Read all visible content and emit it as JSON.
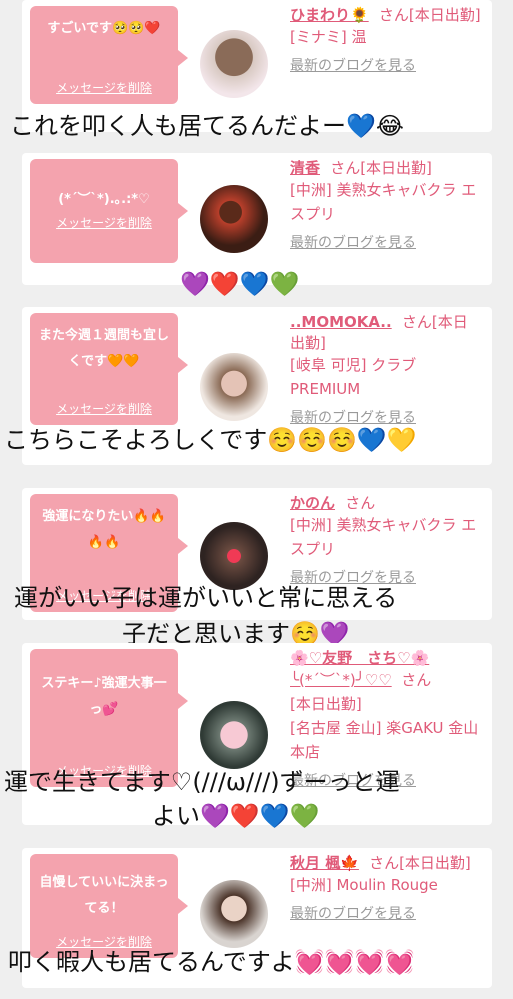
{
  "cards": [
    {
      "message": "すごいです🥺🥺❤️",
      "delete_label": "メッセージを削除",
      "name": "ひまわり🌻",
      "suffix": "さん[本日出勤]",
      "detail": "[ミナミ] 温",
      "blog": "最新のブログを見る"
    },
    {
      "message": "(*´︶`*).｡.:*♡",
      "delete_label": "メッセージを削除",
      "name": "清香",
      "suffix": "さん[本日出勤]",
      "detail": "[中洲] 美熟女キャバクラ エスプリ",
      "blog": "最新のブログを見る"
    },
    {
      "message": "また今週１週間も宜しくです🧡🧡",
      "delete_label": "メッセージを削除",
      "name": "..MOMOKA..",
      "suffix": "さん[本日出勤]",
      "detail": "[岐阜 可児] クラブ PREMIUM",
      "blog": "最新のブログを見る"
    },
    {
      "message": "強運になりたい🔥🔥🔥🔥",
      "delete_label": "メッセージを削除",
      "name": "かのん",
      "suffix": "さん",
      "detail": "[中洲] 美熟女キャバクラ エスプリ",
      "blog": "最新のブログを見る"
    },
    {
      "message": "ステキー♪強運大事一っ💕",
      "delete_label": "メッセージを削除",
      "name": "🌸♡友野　さち♡🌸",
      "suffix": "さん",
      "name_sub": "╰(*´︶`*)╯♡♡",
      "status": "[本日出勤]",
      "detail": "[名古屋 金山] 楽GAKU 金山本店",
      "blog": "最新のブログを見る"
    },
    {
      "message": "自慢していいに決まってる！",
      "delete_label": "メッセージを削除",
      "name": "秋月 楓🍁",
      "suffix": "さん[本日出勤]",
      "detail": "[中洲] Moulin Rouge",
      "blog": "最新のブログを見る"
    }
  ],
  "overlays": {
    "o1": "これを叩く人も居てるんだよー💙😂",
    "o2": "💜❤️💙💚",
    "o3": "こちらこそよろしくです☺️☺️☺️💙💛",
    "o4a": "運がいい子は運がいいと常に思える",
    "o4b": "子だと思います☺️💜",
    "o5a": "運で生きてます♡(///ω///)ずーっと運",
    "o5b": "よい💜❤️💙💚",
    "o6": "叩く暇人も居てるんですよ💓💓💓💓"
  },
  "colors": {
    "bubble": "#f4a3ae",
    "accent": "#e05b79",
    "background": "#efefef"
  }
}
